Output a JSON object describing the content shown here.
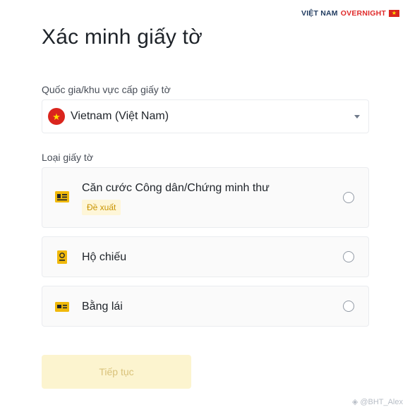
{
  "brand": {
    "part1": "VIỆT NAM",
    "part2": "OVERNIGHT",
    "flag_star": "★"
  },
  "page": {
    "title": "Xác minh giấy tờ"
  },
  "country": {
    "label": "Quốc gia/khu vực cấp giấy tờ",
    "flag_star": "★",
    "selected": "Vietnam (Việt Nam)"
  },
  "doctype": {
    "label": "Loại giấy tờ",
    "options": [
      {
        "label": "Căn cước Công dân/Chứng minh thư",
        "badge": "Đề xuất",
        "icon": "id-card-icon",
        "selected": false
      },
      {
        "label": "Hộ chiếu",
        "icon": "passport-icon",
        "selected": false
      },
      {
        "label": "Bằng lái",
        "icon": "driver-license-icon",
        "selected": false
      }
    ]
  },
  "actions": {
    "continue": "Tiếp tục"
  },
  "watermark": "@BHT_Alex",
  "colors": {
    "accent": "#f0b90b",
    "disabled_button_bg": "#fcf4cf",
    "disabled_button_text": "#d9c27a",
    "flag_red": "#da251d"
  }
}
